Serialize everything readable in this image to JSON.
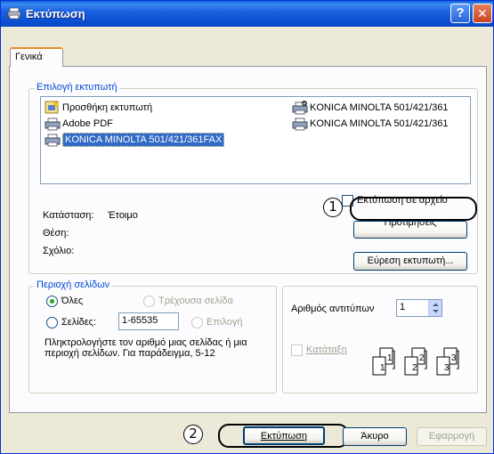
{
  "window": {
    "title": "Εκτύπωση",
    "help_glyph": "?",
    "close_glyph": "✕"
  },
  "tabs": [
    {
      "label": "Γενικά"
    }
  ],
  "select_printer": {
    "legend": "Επιλογή εκτυπωτή",
    "printers": [
      {
        "name": "Προσθήκη εκτυπωτή",
        "icon": "add-printer-icon"
      },
      {
        "name": "Adobe PDF",
        "icon": "printer-icon"
      },
      {
        "name": "KONICA MINOLTA 501/421/361FAX",
        "icon": "printer-icon",
        "selected": true
      },
      {
        "name": "KONICA MINOLTA 501/421/361",
        "icon": "default-printer-icon"
      },
      {
        "name": "KONICA MINOLTA 501/421/361",
        "icon": "printer-icon"
      }
    ],
    "status_label": "Κατάσταση:",
    "status_value": "Έτοιμο",
    "location_label": "Θέση:",
    "comment_label": "Σχόλιο:",
    "print_to_file": "Εκτύπωση σε αρχείο",
    "preferences": "Προτιμήσεις",
    "find_printer": "Εύρεση εκτυπωτή..."
  },
  "page_range": {
    "legend": "Περιοχή σελίδων",
    "all": "Όλες",
    "current_page": "Τρέχουσα σελίδα",
    "pages": "Σελίδες:",
    "pages_value": "1-65535",
    "selection": "Επιλογή",
    "hint": "Πληκτρολογήστε τον αριθμό μιας σελίδας ή μια περιοχή σελίδων. Για παράδειγμα, 5-12"
  },
  "copies": {
    "label": "Αριθμός αντιτύπων",
    "value": "1",
    "collate": "Κατάταξη",
    "collate_pages": [
      "1",
      "1",
      "2",
      "2",
      "3",
      "3"
    ]
  },
  "buttons": {
    "print": "Εκτύπωση",
    "cancel": "Άκυρο",
    "apply": "Εφαρμογή"
  },
  "callouts": [
    "1",
    "2"
  ]
}
